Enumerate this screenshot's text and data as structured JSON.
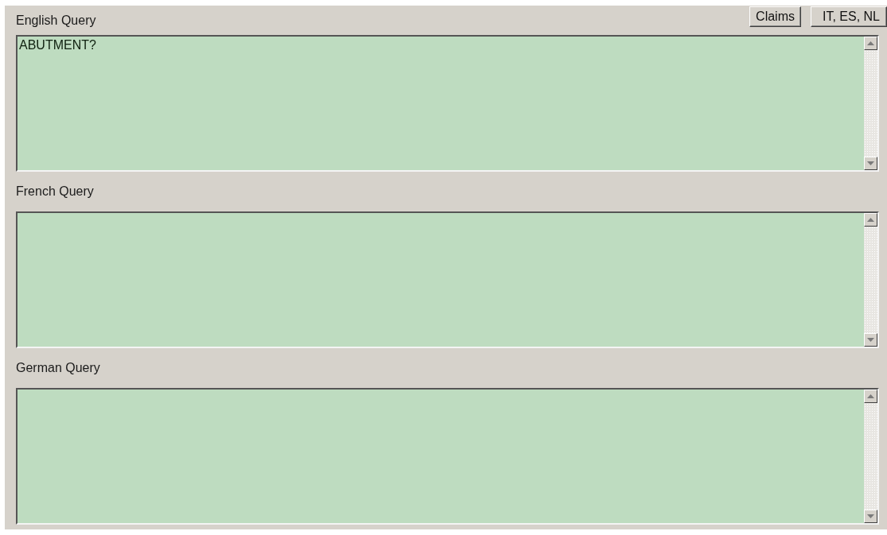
{
  "buttons": [
    {
      "label": "Claims"
    },
    {
      "label": "IT, ES, NL"
    }
  ],
  "queries": [
    {
      "label": "English Query",
      "value": "ABUTMENT?"
    },
    {
      "label": "French Query"
    },
    {
      "label": "German Query"
    }
  ]
}
